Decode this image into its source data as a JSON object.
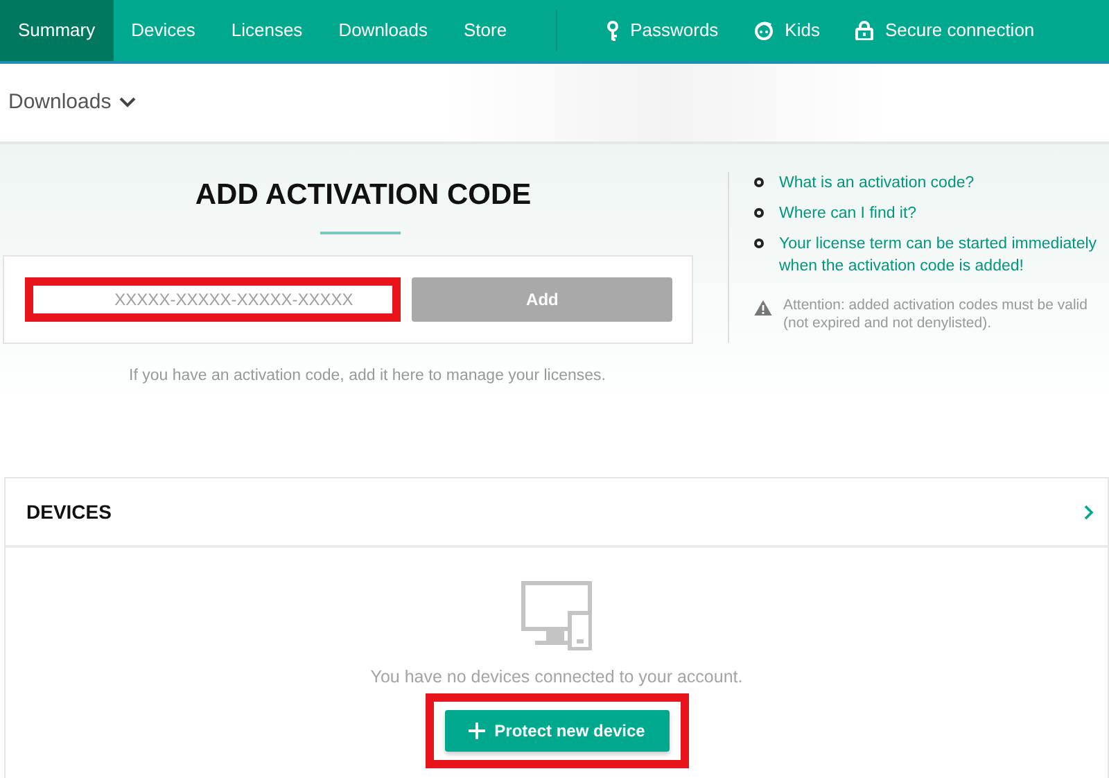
{
  "nav": {
    "tabs": [
      {
        "label": "Summary",
        "selected": true
      },
      {
        "label": "Devices",
        "selected": false
      },
      {
        "label": "Licenses",
        "selected": false
      },
      {
        "label": "Downloads",
        "selected": false
      },
      {
        "label": "Store",
        "selected": false
      }
    ],
    "extras": [
      {
        "label": "Passwords",
        "kind": "key"
      },
      {
        "label": "Kids",
        "kind": "kids"
      },
      {
        "label": "Secure connection",
        "kind": "lock"
      }
    ]
  },
  "page_menu": {
    "label": "Downloads"
  },
  "activation": {
    "title": "ADD ACTIVATION CODE",
    "field": {
      "placeholder": "XXXXX-XXXXX-XXXXX-XXXXX",
      "highlighted": true
    },
    "button": {
      "label": "Add",
      "disabled": true
    },
    "hint": "If you have an activation code, add it here to manage your licenses.",
    "links": [
      "What is an activation code?",
      "Where can I find it?",
      "Your license term can be started immediately when the activation code is added!"
    ],
    "warning": "Attention: added activation codes must be valid (not expired and not denylisted)."
  },
  "devices": {
    "title": "DEVICES",
    "empty_text": "You have no devices connected to your account.",
    "button": {
      "label": "Protect new device",
      "highlighted": true
    }
  }
}
